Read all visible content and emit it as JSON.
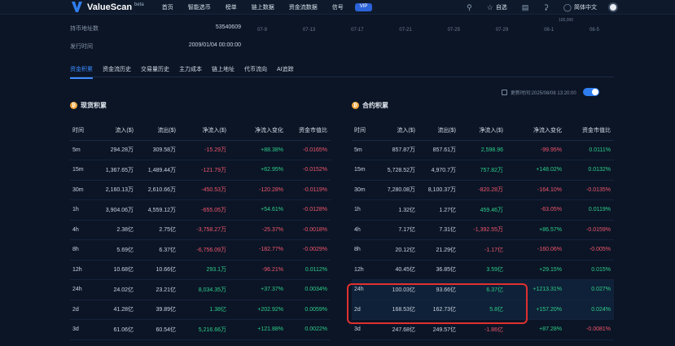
{
  "header": {
    "brand": "ValueScan",
    "beta": "beta",
    "nav": [
      "首页",
      "智能选币",
      "榜单",
      "链上数据",
      "资金流数据",
      "信号"
    ],
    "vip": "VIP",
    "watchlist": "自选",
    "language": "简体中文",
    "icons": [
      "search-icon",
      "star-icon",
      "chart-icon",
      "bell-icon",
      "globe-icon"
    ]
  },
  "info": {
    "row1_label": "持币地址数",
    "row1_value": "53540609",
    "row2_label": "发行时间",
    "row2_value": "2009/01/04 00:00:00",
    "dates": [
      "07-9",
      "07-13",
      "07-17",
      "07-21",
      "07-25",
      "07-29",
      "08-1",
      "08-5"
    ],
    "corner_value": "100,000"
  },
  "tabs": [
    "资金积累",
    "资金流历史",
    "交易量历史",
    "主力成本",
    "链上地址",
    "代币流向",
    "AI追踪"
  ],
  "update_text": "更新时间:2025/08/08 13:20:00",
  "spot": {
    "title": "现货积累",
    "columns": [
      "时间",
      "流入($)",
      "流出($)",
      "净流入($)",
      "净流入变化",
      "资金市值比"
    ],
    "rows": [
      [
        "5m",
        "294.28万",
        "309.58万",
        "-15.29万",
        "+88.38%",
        "-0.0165%"
      ],
      [
        "15m",
        "1,367.65万",
        "1,489.44万",
        "-121.79万",
        "+62.95%",
        "-0.0152%"
      ],
      [
        "30m",
        "2,160.13万",
        "2,610.66万",
        "-450.53万",
        "-120.28%",
        "-0.0119%"
      ],
      [
        "1h",
        "3,904.06万",
        "4,559.12万",
        "-655.05万",
        "+54.61%",
        "-0.0128%"
      ],
      [
        "4h",
        "2.38亿",
        "2.75亿",
        "-3,758.27万",
        "-25.37%",
        "-0.0018%"
      ],
      [
        "8h",
        "5.69亿",
        "6.37亿",
        "-6,756.09万",
        "-182.77%",
        "-0.0029%"
      ],
      [
        "12h",
        "10.68亿",
        "10.66亿",
        "293.1万",
        "-96.21%",
        "0.0112%"
      ],
      [
        "24h",
        "24.02亿",
        "23.21亿",
        "8,034.35万",
        "+37.37%",
        "0.0034%"
      ],
      [
        "2d",
        "41.28亿",
        "39.89亿",
        "1.38亿",
        "+202.92%",
        "0.0059%"
      ],
      [
        "3d",
        "61.06亿",
        "60.54亿",
        "5,216.66万",
        "+121.88%",
        "0.0022%"
      ]
    ]
  },
  "futures": {
    "title": "合约积累",
    "columns": [
      "时间",
      "流入($)",
      "流出($)",
      "净流入($)",
      "净流入变化",
      "资金市值比"
    ],
    "rows": [
      [
        "5m",
        "857.87万",
        "857.61万",
        "2,598.96",
        "-99.95%",
        "0.0111%"
      ],
      [
        "15m",
        "5,728.52万",
        "4,970.7万",
        "757.82万",
        "+148.02%",
        "0.0132%"
      ],
      [
        "30m",
        "7,280.08万",
        "8,100.37万",
        "-820.28万",
        "-164.10%",
        "-0.0135%"
      ],
      [
        "1h",
        "1.32亿",
        "1.27亿",
        "459.46万",
        "-63.05%",
        "0.0119%"
      ],
      [
        "4h",
        "7.17亿",
        "7.31亿",
        "-1,392.55万",
        "+86.57%",
        "-0.0159%"
      ],
      [
        "8h",
        "20.12亿",
        "21.29亿",
        "-1.17亿",
        "-160.06%",
        "-0.005%"
      ],
      [
        "12h",
        "40.45亿",
        "36.85亿",
        "3.59亿",
        "+29.15%",
        "0.015%"
      ],
      [
        "24h",
        "100.03亿",
        "93.66亿",
        "6.37亿",
        "+1213.31%",
        "0.027%"
      ],
      [
        "2d",
        "168.53亿",
        "162.73亿",
        "5.8亿",
        "+157.20%",
        "0.024%"
      ],
      [
        "3d",
        "247.68亿",
        "249.57亿",
        "-1.86亿",
        "+87.28%",
        "-0.0081%"
      ]
    ]
  },
  "colors": {
    "positive": "#2ecf8a",
    "negative": "#f2566c",
    "accent": "#3d8bff",
    "highlight": "#e0302f"
  }
}
